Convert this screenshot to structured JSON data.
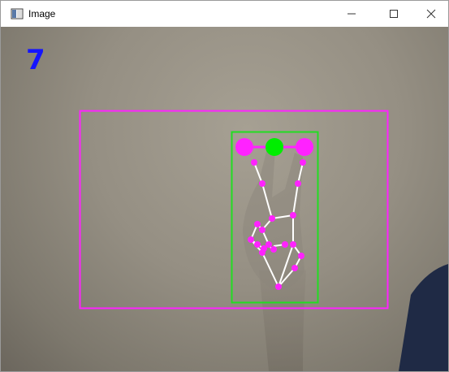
{
  "window": {
    "title": "Image",
    "icons": {
      "app": "opencv-window-icon",
      "minimize": "minimize-icon",
      "maximize": "maximize-icon",
      "close": "close-icon"
    }
  },
  "overlay": {
    "finger_count": "7",
    "colors": {
      "finger_count": "#1414ff",
      "outer_box": "#ff22ff",
      "hand_box": "#22dd22",
      "landmark_points": "#ff22ff",
      "connections": "#ffffff",
      "center_point": "#00ee00"
    }
  }
}
